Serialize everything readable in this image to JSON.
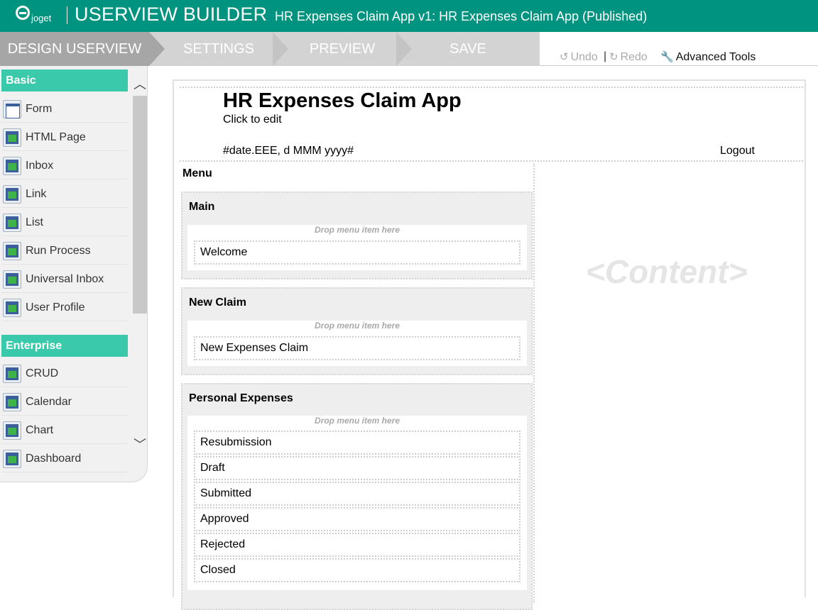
{
  "header": {
    "logo_text": "joget",
    "title": "USERVIEW BUILDER",
    "subtitle": "HR Expenses Claim App v1: HR Expenses Claim App (Published)"
  },
  "steps": [
    "DESIGN USERVIEW",
    "SETTINGS",
    "PREVIEW",
    "SAVE"
  ],
  "toolbar": {
    "undo": "Undo",
    "redo": "Redo",
    "separator": "|",
    "advanced": "Advanced Tools"
  },
  "palette": {
    "basic": {
      "label": "Basic",
      "items": [
        "Form",
        "HTML Page",
        "Inbox",
        "Link",
        "List",
        "Run Process",
        "Universal Inbox",
        "User Profile"
      ]
    },
    "enterprise": {
      "label": "Enterprise",
      "items": [
        "CRUD",
        "Calendar",
        "Chart",
        "Dashboard"
      ]
    }
  },
  "userview": {
    "title": "HR Expenses Claim App",
    "description": "Click to edit",
    "date": "#date.EEE, d MMM yyyy#",
    "logout": "Logout",
    "menu_label": "Menu",
    "content_placeholder": "<Content>",
    "drop_hint": "Drop menu item here",
    "categories": [
      {
        "label": "Main",
        "items": [
          "Welcome"
        ]
      },
      {
        "label": "New Claim",
        "items": [
          "New Expenses Claim"
        ]
      },
      {
        "label": "Personal Expenses",
        "items": [
          "Resubmission",
          "Draft",
          "Submitted",
          "Approved",
          "Rejected",
          "Closed"
        ]
      }
    ]
  },
  "colors": {
    "header_bg": "#00937f",
    "category_header": "#3bc9ab",
    "active_step": "#a6a6a6",
    "inactive_step": "#d3d3d3"
  }
}
